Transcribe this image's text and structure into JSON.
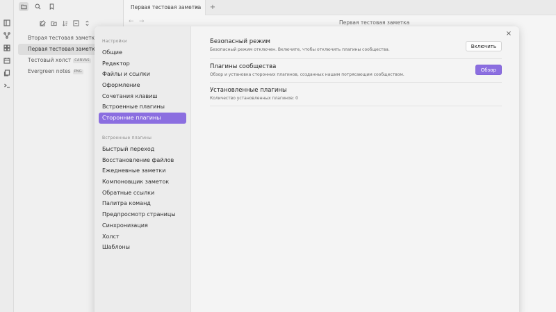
{
  "explorer": {
    "files": [
      {
        "name": "Вторая тестовая заметка",
        "tag": ""
      },
      {
        "name": "Первая тестовая заметка",
        "tag": ""
      },
      {
        "name": "Тестовый холст",
        "tag": "CANVAS"
      },
      {
        "name": "Evergreen notes",
        "tag": "PNG"
      }
    ]
  },
  "tabs": {
    "active_label": "Первая тестовая заметка",
    "close_glyph": "×",
    "new_glyph": "+"
  },
  "nav": {
    "back": "←",
    "forward": "→"
  },
  "note": {
    "title": "Первая тестовая заметка"
  },
  "settings": {
    "close_glyph": "×",
    "sidebar": {
      "section_settings": "Настройки",
      "settings_items": [
        "Общие",
        "Редактор",
        "Файлы и ссылки",
        "Оформление",
        "Сочетания клавиш",
        "Встроенные плагины",
        "Сторонние плагины"
      ],
      "section_core": "Встроенные плагины",
      "core_items": [
        "Быстрый переход",
        "Восстановление файлов",
        "Ежедневные заметки",
        "Компоновщик заметок",
        "Обратные ссылки",
        "Палитра команд",
        "Предпросмотр страницы",
        "Синхронизация",
        "Холст",
        "Шаблоны"
      ]
    },
    "safe_mode": {
      "title": "Безопасный режим",
      "desc": "Безопасный режим отключен. Включите, чтобы отключить плагины сообщества.",
      "button": "Включить"
    },
    "community": {
      "title": "Плагины сообщества",
      "desc": "Обзор и установка сторонних плагинов, созданных нашим потрясающим сообществом.",
      "button": "Обзор"
    },
    "installed": {
      "title": "Установленные плагины",
      "desc": "Количество установленных плагинов: 0"
    }
  }
}
